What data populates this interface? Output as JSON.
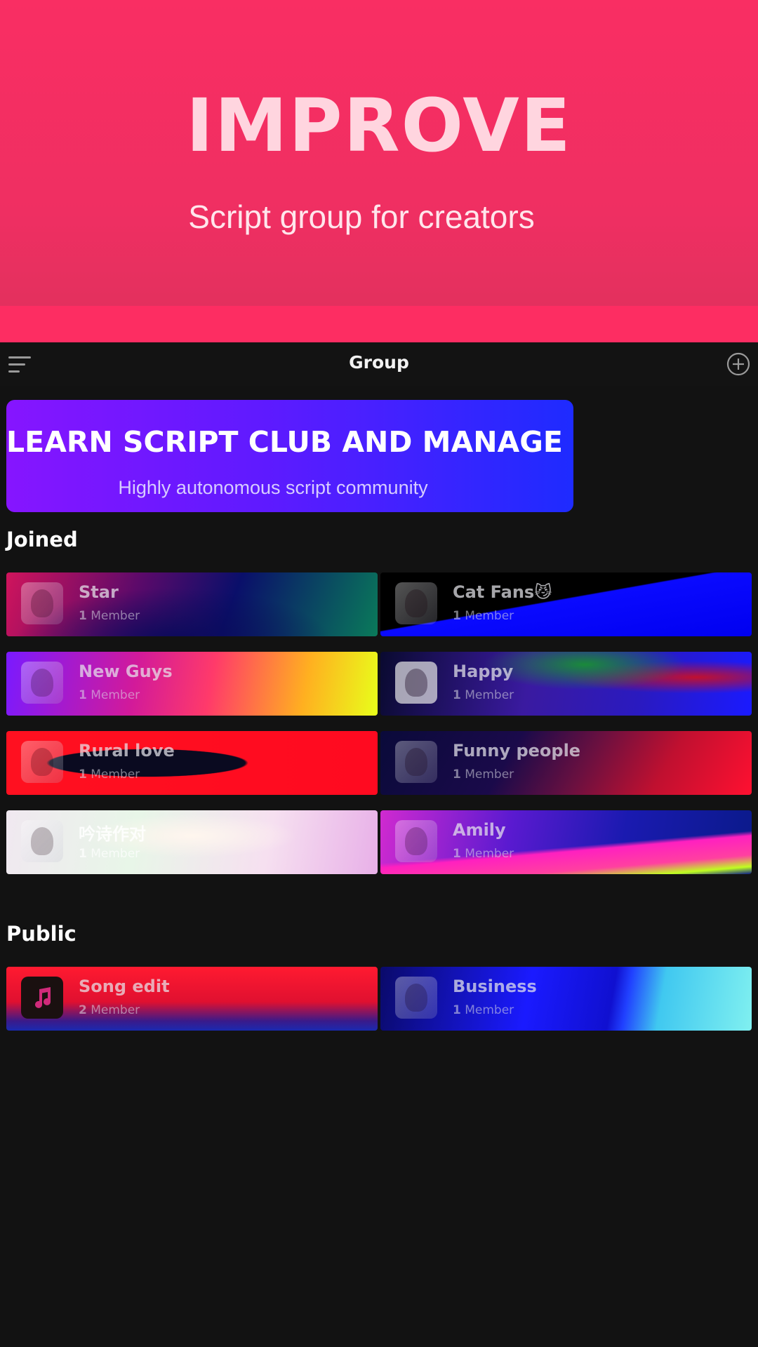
{
  "promo": {
    "title": "IMPROVE",
    "subtitle": "Script group for creators"
  },
  "appbar": {
    "title": "Group",
    "menu_icon": "menu-icon",
    "add_icon": "add-circle-icon"
  },
  "banner": {
    "title": "LEARN SCRIPT CLUB AND MANAGE IT",
    "subtitle": "Highly autonomous script community"
  },
  "joined": {
    "title": "Joined",
    "groups": [
      {
        "name": "Star",
        "count": "1",
        "unit": "Member"
      },
      {
        "name": "Cat Fans😼",
        "count": "1",
        "unit": "Member"
      },
      {
        "name": "New Guys",
        "count": "1",
        "unit": "Member"
      },
      {
        "name": "Happy",
        "count": "1",
        "unit": "Member"
      },
      {
        "name": "Rural love",
        "count": "1",
        "unit": "Member"
      },
      {
        "name": "Funny people",
        "count": "1",
        "unit": "Member"
      },
      {
        "name": "吟诗作对",
        "count": "1",
        "unit": "Member"
      },
      {
        "name": "Amily",
        "count": "1",
        "unit": "Member"
      }
    ]
  },
  "public": {
    "title": "Public",
    "groups": [
      {
        "name": "Song edit",
        "count": "2",
        "unit": "Member"
      },
      {
        "name": "Business",
        "count": "1",
        "unit": "Member"
      }
    ]
  },
  "colors": {
    "promo_bg": "#fd2d62",
    "app_bg": "#121212",
    "banner_start": "#8615ff",
    "banner_end": "#1e2bff"
  }
}
